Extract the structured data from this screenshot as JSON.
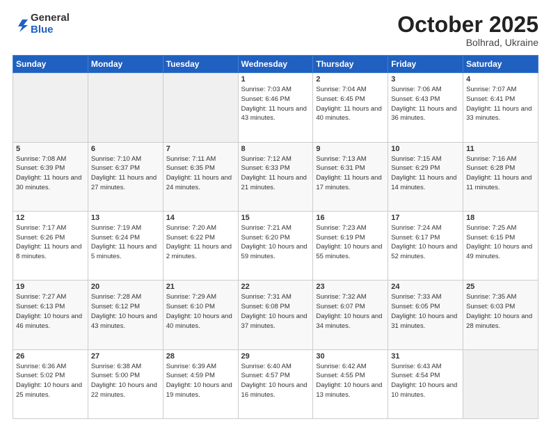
{
  "header": {
    "logo": {
      "general": "General",
      "blue": "Blue"
    },
    "title": "October 2025",
    "subtitle": "Bolhrad, Ukraine"
  },
  "weekdays": [
    "Sunday",
    "Monday",
    "Tuesday",
    "Wednesday",
    "Thursday",
    "Friday",
    "Saturday"
  ],
  "weeks": [
    [
      {
        "day": "",
        "info": ""
      },
      {
        "day": "",
        "info": ""
      },
      {
        "day": "",
        "info": ""
      },
      {
        "day": "1",
        "info": "Sunrise: 7:03 AM\nSunset: 6:46 PM\nDaylight: 11 hours and 43 minutes."
      },
      {
        "day": "2",
        "info": "Sunrise: 7:04 AM\nSunset: 6:45 PM\nDaylight: 11 hours and 40 minutes."
      },
      {
        "day": "3",
        "info": "Sunrise: 7:06 AM\nSunset: 6:43 PM\nDaylight: 11 hours and 36 minutes."
      },
      {
        "day": "4",
        "info": "Sunrise: 7:07 AM\nSunset: 6:41 PM\nDaylight: 11 hours and 33 minutes."
      }
    ],
    [
      {
        "day": "5",
        "info": "Sunrise: 7:08 AM\nSunset: 6:39 PM\nDaylight: 11 hours and 30 minutes."
      },
      {
        "day": "6",
        "info": "Sunrise: 7:10 AM\nSunset: 6:37 PM\nDaylight: 11 hours and 27 minutes."
      },
      {
        "day": "7",
        "info": "Sunrise: 7:11 AM\nSunset: 6:35 PM\nDaylight: 11 hours and 24 minutes."
      },
      {
        "day": "8",
        "info": "Sunrise: 7:12 AM\nSunset: 6:33 PM\nDaylight: 11 hours and 21 minutes."
      },
      {
        "day": "9",
        "info": "Sunrise: 7:13 AM\nSunset: 6:31 PM\nDaylight: 11 hours and 17 minutes."
      },
      {
        "day": "10",
        "info": "Sunrise: 7:15 AM\nSunset: 6:29 PM\nDaylight: 11 hours and 14 minutes."
      },
      {
        "day": "11",
        "info": "Sunrise: 7:16 AM\nSunset: 6:28 PM\nDaylight: 11 hours and 11 minutes."
      }
    ],
    [
      {
        "day": "12",
        "info": "Sunrise: 7:17 AM\nSunset: 6:26 PM\nDaylight: 11 hours and 8 minutes."
      },
      {
        "day": "13",
        "info": "Sunrise: 7:19 AM\nSunset: 6:24 PM\nDaylight: 11 hours and 5 minutes."
      },
      {
        "day": "14",
        "info": "Sunrise: 7:20 AM\nSunset: 6:22 PM\nDaylight: 11 hours and 2 minutes."
      },
      {
        "day": "15",
        "info": "Sunrise: 7:21 AM\nSunset: 6:20 PM\nDaylight: 10 hours and 59 minutes."
      },
      {
        "day": "16",
        "info": "Sunrise: 7:23 AM\nSunset: 6:19 PM\nDaylight: 10 hours and 55 minutes."
      },
      {
        "day": "17",
        "info": "Sunrise: 7:24 AM\nSunset: 6:17 PM\nDaylight: 10 hours and 52 minutes."
      },
      {
        "day": "18",
        "info": "Sunrise: 7:25 AM\nSunset: 6:15 PM\nDaylight: 10 hours and 49 minutes."
      }
    ],
    [
      {
        "day": "19",
        "info": "Sunrise: 7:27 AM\nSunset: 6:13 PM\nDaylight: 10 hours and 46 minutes."
      },
      {
        "day": "20",
        "info": "Sunrise: 7:28 AM\nSunset: 6:12 PM\nDaylight: 10 hours and 43 minutes."
      },
      {
        "day": "21",
        "info": "Sunrise: 7:29 AM\nSunset: 6:10 PM\nDaylight: 10 hours and 40 minutes."
      },
      {
        "day": "22",
        "info": "Sunrise: 7:31 AM\nSunset: 6:08 PM\nDaylight: 10 hours and 37 minutes."
      },
      {
        "day": "23",
        "info": "Sunrise: 7:32 AM\nSunset: 6:07 PM\nDaylight: 10 hours and 34 minutes."
      },
      {
        "day": "24",
        "info": "Sunrise: 7:33 AM\nSunset: 6:05 PM\nDaylight: 10 hours and 31 minutes."
      },
      {
        "day": "25",
        "info": "Sunrise: 7:35 AM\nSunset: 6:03 PM\nDaylight: 10 hours and 28 minutes."
      }
    ],
    [
      {
        "day": "26",
        "info": "Sunrise: 6:36 AM\nSunset: 5:02 PM\nDaylight: 10 hours and 25 minutes."
      },
      {
        "day": "27",
        "info": "Sunrise: 6:38 AM\nSunset: 5:00 PM\nDaylight: 10 hours and 22 minutes."
      },
      {
        "day": "28",
        "info": "Sunrise: 6:39 AM\nSunset: 4:59 PM\nDaylight: 10 hours and 19 minutes."
      },
      {
        "day": "29",
        "info": "Sunrise: 6:40 AM\nSunset: 4:57 PM\nDaylight: 10 hours and 16 minutes."
      },
      {
        "day": "30",
        "info": "Sunrise: 6:42 AM\nSunset: 4:55 PM\nDaylight: 10 hours and 13 minutes."
      },
      {
        "day": "31",
        "info": "Sunrise: 6:43 AM\nSunset: 4:54 PM\nDaylight: 10 hours and 10 minutes."
      },
      {
        "day": "",
        "info": ""
      }
    ]
  ]
}
